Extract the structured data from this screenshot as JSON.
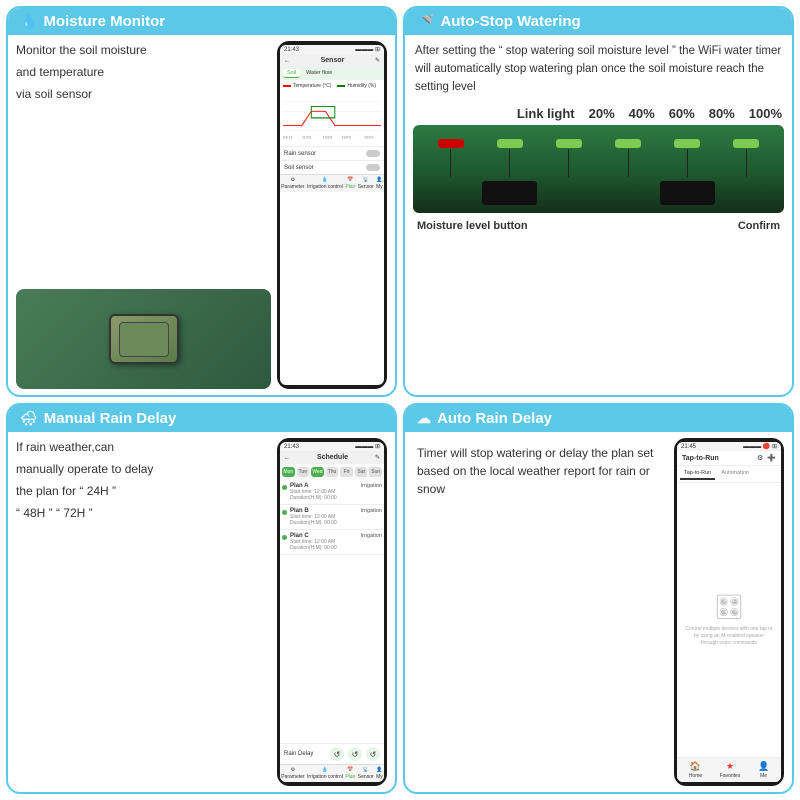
{
  "cards": {
    "moisture_monitor": {
      "title": "Moisture Monitor",
      "description_line1": "Monitor the soil moisture",
      "description_line2": "and temperature",
      "description_line3": "via soil sensor",
      "phone": {
        "status_bar_time": "21:43",
        "status_bar_icons": "◀ ◀ ▬ ▬ ▬",
        "back_icon": "←",
        "title": "Sensor",
        "edit_icon": "✎",
        "tab_soil": "Soil",
        "tab_water": "Water flow",
        "legend_temp": "Temperature (°C)",
        "legend_humidity": "Humidity (%)",
        "dates": [
          "04/13",
          "11/03",
          "18/03",
          "16/03",
          "20/03"
        ],
        "rain_sensor_label": "Rain sensor",
        "soil_sensor_label": "Soil sensor",
        "nav_items": [
          "Parameter",
          "Irrigation control",
          "Plan",
          "Sensor",
          "My"
        ]
      }
    },
    "auto_stop": {
      "title": "Auto-Stop Watering",
      "description": "After setting the “ stop watering soil moisture level ” the WiFi water timer will automatically stop watering plan once the soil moisture reach the setting level",
      "link_light_label": "Link light",
      "moisture_levels": [
        "20%",
        "40%",
        "60%",
        "80%",
        "100%"
      ],
      "moisture_level_button_label": "Moisture level button",
      "confirm_label": "Confirm"
    },
    "manual_rain": {
      "title": "Manual Rain Delay",
      "description_line1": "If rain weather,can",
      "description_line2": "manually operate to delay",
      "description_line3": "the plan for “ 24H ”",
      "description_line4": "“ 48H ” “ 72H ”",
      "phone": {
        "status_bar_time": "21:43",
        "back_icon": "←",
        "title": "Schedule",
        "edit_icon": "✎",
        "days": [
          "Mon",
          "Tue",
          "Wed",
          "Thu",
          "Fri",
          "Sat",
          "Sun"
        ],
        "plan_a_name": "Plan A",
        "plan_a_type": "Irrigation",
        "plan_a_start": "Start time: 12:00 AM",
        "plan_a_duration": "Duration(H:M): 00:00",
        "plan_b_name": "Plan B",
        "plan_b_type": "Irrigation",
        "plan_b_start": "Start time: 12:00 AM",
        "plan_b_duration": "Duration(H:M): 00:00",
        "plan_c_name": "Plan C",
        "plan_c_type": "Irrigation",
        "plan_c_start": "Start time: 12:00 AM",
        "plan_c_duration": "Duration(H:M): 00:00",
        "rain_delay_label": "Rain Delay",
        "nav_items": [
          "Parameter",
          "Irrigation control",
          "Plan",
          "Sensor",
          "My"
        ]
      }
    },
    "auto_rain": {
      "title": "Auto Rain Delay",
      "description": "Timer will stop watering or delay the plan set based on the local weather report for rain or snow",
      "phone": {
        "status_bar_time": "21:45",
        "title": "Tap-to-Run",
        "tab_tap": "Tap-to-Run",
        "tab_automation": "Automation",
        "empty_desc": "Control multiple devices with one tap or by using an AI-enabled speaker through voice commands",
        "nav_home": "Home",
        "nav_favorites": "Favorites",
        "nav_profile": "Me"
      }
    }
  }
}
